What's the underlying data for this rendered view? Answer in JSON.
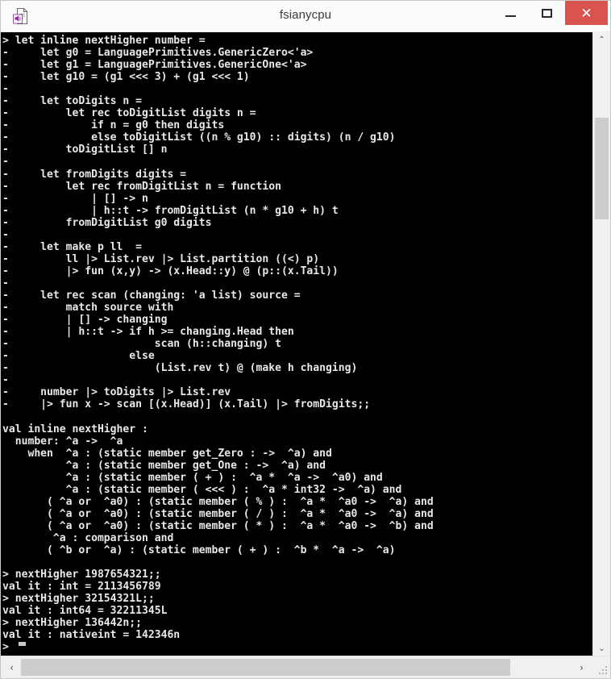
{
  "window": {
    "title": "fsianycpu",
    "icon": "fsharp-script-file-icon",
    "minimize_label": "—",
    "maximize_label": "☐",
    "close_label": "✕"
  },
  "scrollbars": {
    "vertical": {
      "up_arrow": "⌃",
      "down_arrow": "⌄",
      "thumb_top_pct": 12,
      "thumb_height_pct": 17
    },
    "horizontal": {
      "left_arrow": "‹",
      "right_arrow": "›",
      "thumb_left_pct": 0,
      "thumb_width_pct": 86
    }
  },
  "console": {
    "prompt": ">",
    "continuation_prompt": "-",
    "cursor": "block",
    "foreground_color": "#e8e8e8",
    "background_color": "#000000",
    "text": "> let inline nextHigher number =\n-     let g0 = LanguagePrimitives.GenericZero<'a>\n-     let g1 = LanguagePrimitives.GenericOne<'a>\n-     let g10 = (g1 <<< 3) + (g1 <<< 1)\n-\n-     let toDigits n =\n-         let rec toDigitList digits n =\n-             if n = g0 then digits\n-             else toDigitList ((n % g10) :: digits) (n / g10)\n-         toDigitList [] n\n-\n-     let fromDigits digits =\n-         let rec fromDigitList n = function\n-             | [] -> n\n-             | h::t -> fromDigitList (n * g10 + h) t\n-         fromDigitList g0 digits\n-\n-     let make p ll  =\n-         ll |> List.rev |> List.partition ((<) p)\n-         |> fun (x,y) -> (x.Head::y) @ (p::(x.Tail))\n-\n-     let rec scan (changing: 'a list) source =\n-         match source with\n-         | [] -> changing\n-         | h::t -> if h >= changing.Head then\n-                       scan (h::changing) t\n-                   else\n-                       (List.rev t) @ (make h changing)\n-\n-     number |> toDigits |> List.rev\n-     |> fun x -> scan [(x.Head)] (x.Tail) |> fromDigits;;\n\nval inline nextHigher :\n  number: ^a ->  ^a\n    when  ^a : (static member get_Zero : ->  ^a) and\n          ^a : (static member get_One : ->  ^a) and\n          ^a : (static member ( + ) :  ^a *  ^a ->  ^a0) and\n          ^a : (static member ( <<< ) :  ^a * int32 ->  ^a) and\n       ( ^a or  ^a0) : (static member ( % ) :  ^a *  ^a0 ->  ^a) and\n       ( ^a or  ^a0) : (static member ( / ) :  ^a *  ^a0 ->  ^a) and\n       ( ^a or  ^a0) : (static member ( * ) :  ^a *  ^a0 ->  ^b) and\n        ^a : comparison and\n       ( ^b or  ^a) : (static member ( + ) :  ^b *  ^a ->  ^a)\n\n> nextHigher 1987654321;;\nval it : int = 2113456789\n> nextHigher 32154321L;;\nval it : int64 = 32211345L\n> nextHigher 136442n;;\nval it : nativeint = 142346n\n>"
  }
}
